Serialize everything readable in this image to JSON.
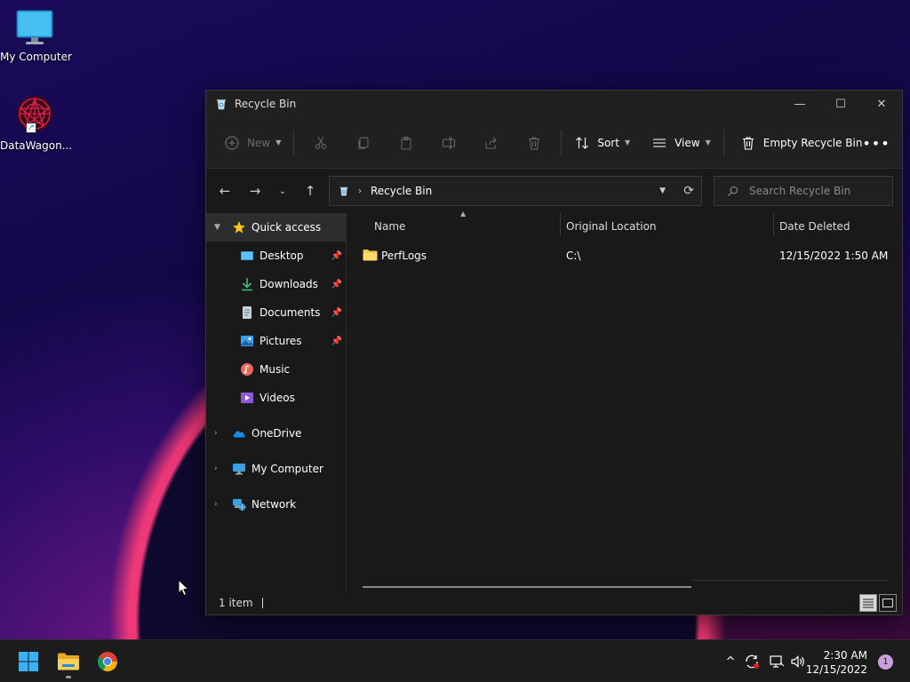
{
  "desktop": {
    "icons": [
      {
        "label": "My Computer"
      },
      {
        "label": "DataWagon..."
      }
    ]
  },
  "window": {
    "title": "Recycle Bin",
    "controls": {
      "minimize": "—",
      "maximize": "☐",
      "close": "✕"
    }
  },
  "commandbar": {
    "new_label": "New",
    "sort_label": "Sort",
    "view_label": "View",
    "empty_label": "Empty Recycle Bin",
    "more_label": "•••"
  },
  "navigation": {
    "address": "Recycle Bin",
    "search_placeholder": "Search Recycle Bin"
  },
  "sidebar": {
    "items": [
      {
        "label": "Quick access"
      },
      {
        "label": "Desktop"
      },
      {
        "label": "Downloads"
      },
      {
        "label": "Documents"
      },
      {
        "label": "Pictures"
      },
      {
        "label": "Music"
      },
      {
        "label": "Videos"
      },
      {
        "label": "OneDrive"
      },
      {
        "label": "My Computer"
      },
      {
        "label": "Network"
      }
    ]
  },
  "columns": {
    "name": "Name",
    "location": "Original Location",
    "deleted": "Date Deleted"
  },
  "files": [
    {
      "name": "PerfLogs",
      "location": "C:\\",
      "deleted": "12/15/2022 1:50 AM"
    }
  ],
  "status": {
    "count": "1 item"
  },
  "taskbar": {
    "time": "2:30 AM",
    "date": "12/15/2022",
    "notifications": "1"
  },
  "colors": {
    "accent": "#0a84ff",
    "folder": "#f5c542"
  }
}
